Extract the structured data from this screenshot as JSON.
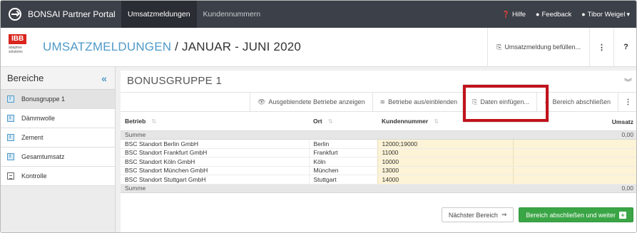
{
  "navbar": {
    "brand": "BONSAI Partner Portal",
    "tabs": [
      {
        "label": "Umsatzmeldungen",
        "active": true
      },
      {
        "label": "Kundennummern",
        "active": false
      }
    ],
    "right": {
      "help": "Hilfe",
      "feedback": "Feedback",
      "user": "Tibor Weigel"
    }
  },
  "header": {
    "logo_text": "IBB",
    "logo_sub": "adaptive solutions",
    "title_highlight": "UMSATZMELDUNGEN",
    "title_rest": " / JANUAR - JUNI 2020",
    "fill_button": "Umsatzmeldung befüllen...",
    "kebab": "⋮",
    "help": "?"
  },
  "sidebar": {
    "title": "Bereiche",
    "collapse": "«",
    "items": [
      {
        "label": "Bonusgruppe 1",
        "icon": "info-icon",
        "active": true
      },
      {
        "label": "Dämmwolle",
        "icon": "info-icon",
        "active": false
      },
      {
        "label": "Zement",
        "icon": "info-icon",
        "active": false
      },
      {
        "label": "Gesamtumsatz",
        "icon": "info-icon",
        "active": false
      },
      {
        "label": "Kontrolle",
        "icon": "clipboard-icon",
        "active": false
      }
    ]
  },
  "panel": {
    "title": "BONUSGRUPPE 1",
    "collapse": "»",
    "toolbar": {
      "show_hidden": "Ausgeblendete Betriebe anzeigen",
      "toggle_sites": "Betriebe aus/einblenden",
      "paste": "Daten einfügen...",
      "close_area": "Bereich abschließen",
      "kebab": "⋮"
    },
    "table": {
      "headers": [
        "Betrieb",
        "Ort",
        "Kundennummer",
        "Umsatz"
      ],
      "summary_label": "Summe",
      "summary_value": "0,00",
      "rows": [
        {
          "betrieb": "BSC Standort Berlin GmbH",
          "ort": "Berlin",
          "kundennummer": "12000;19000",
          "umsatz": ""
        },
        {
          "betrieb": "BSC Standort Frankfurt GmbH",
          "ort": "Frankfurt",
          "kundennummer": "11000",
          "umsatz": ""
        },
        {
          "betrieb": "BSC Standort Köln GmbH",
          "ort": "Köln",
          "kundennummer": "10000",
          "umsatz": ""
        },
        {
          "betrieb": "BSC Standort München GmbH",
          "ort": "München",
          "kundennummer": "13000",
          "umsatz": ""
        },
        {
          "betrieb": "BSC Standort Stuttgart GmbH",
          "ort": "Stuttgart",
          "kundennummer": "14000",
          "umsatz": ""
        }
      ]
    },
    "next_button": "Nächster Bereich",
    "finish_button": "Bereich abschließen und weiter"
  },
  "colors": {
    "navbar": "#3c4048",
    "accent": "#4f9ac8",
    "highlight": "#c1121c",
    "success": "#3aa545",
    "editable_cell": "#fdf3d6"
  }
}
